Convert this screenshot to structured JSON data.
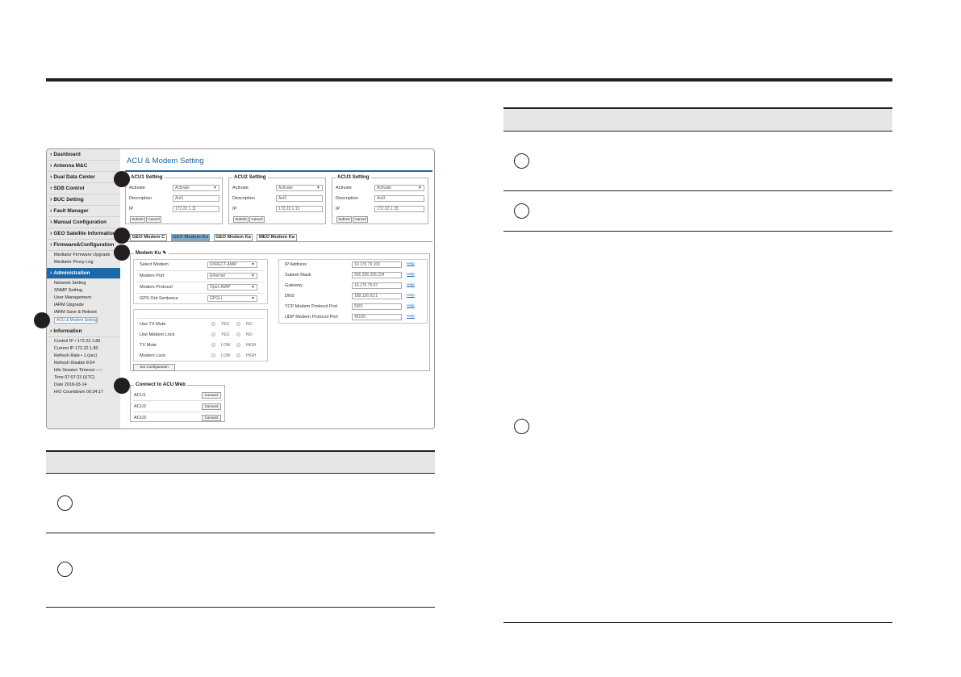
{
  "screenshot": {
    "nav": [
      {
        "label": "Dashboard"
      },
      {
        "label": "Antenna M&C"
      },
      {
        "label": "Dual Data Center"
      },
      {
        "label": "SDB Control"
      },
      {
        "label": "BUC Setting"
      },
      {
        "label": "Fault Manager"
      },
      {
        "label": "Manual Configuration"
      },
      {
        "label": "GEO Satellite Information"
      },
      {
        "label": "Firmware&Configuration"
      },
      {
        "label": "Administration"
      },
      {
        "label": "Information"
      }
    ],
    "firmware_sub": [
      "Mediator Firmware Upgrade",
      "Mediator Proxy Log"
    ],
    "admin_sub": [
      "Network Setting",
      "SNMP Setting",
      "User Management",
      "iARM Upgrade",
      "iARM Save & Reboot",
      "ACU & Modem Setting"
    ],
    "info_lines": [
      "Control IP • 172.22.1.80",
      "Current IP   172.22.1.80",
      "Refresh Rate •     1 (sec)",
      "Refresh Disable   8:54",
      "Idle Session Timeout  --:--",
      "Time  07:07:23 (UTC)",
      "Date  2018-03-14",
      "H/O Countdown   00:34:17"
    ],
    "page_title": "ACU & Modem Setting",
    "acu_panels": [
      {
        "legend": "ACU1 Setting",
        "activate_label": "Activate",
        "activate_value": "Activate",
        "desc_label": "Description",
        "desc_value": "Ant1",
        "ip_label": "IP",
        "ip_value": "172.22.1.11",
        "submit": "Submit",
        "cancel": "Cancel"
      },
      {
        "legend": "ACU2 Setting",
        "activate_label": "Activate",
        "activate_value": "Activate",
        "desc_label": "Description",
        "desc_value": "Ant2",
        "ip_label": "IP",
        "ip_value": "172.22.1.13",
        "submit": "Submit",
        "cancel": "Cancel"
      },
      {
        "legend": "ACU3 Setting",
        "activate_label": "Activate",
        "activate_value": "Activate",
        "desc_label": "Description",
        "desc_value": "Ant3",
        "ip_label": "IP",
        "ip_value": "172.22.1.15",
        "submit": "Submit",
        "cancel": "Cancel"
      }
    ],
    "tabs": [
      "GEO Modem C",
      "GEO Modem Ku",
      "GEO Modem Ka",
      "MEO Modem Ka"
    ],
    "modem_legend": "Modem Ku",
    "modem_left": [
      {
        "label": "Select Modem",
        "value": "IDIRECT-AMIP"
      },
      {
        "label": "Modem Port",
        "value": "Ethernet"
      },
      {
        "label": "Modem Protocol",
        "value": "Open AMIP"
      },
      {
        "label": "GPS Out Sentence",
        "value": "GPGLL"
      }
    ],
    "modem_right": [
      {
        "label": "IP Address",
        "value": "10.170.79.100",
        "help": "Help"
      },
      {
        "label": "Subnet Mask",
        "value": "255.255.255.224",
        "help": "Help"
      },
      {
        "label": "Gateway",
        "value": "10.170.79.97",
        "help": "Help"
      },
      {
        "label": "DNS",
        "value": "168.126.63.1",
        "help": "Help"
      },
      {
        "label": "TCP Modem Protocol Port",
        "value": "5001",
        "help": "Help"
      },
      {
        "label": "UDP Modem Protocol Port",
        "value": "45105",
        "help": "Help"
      }
    ],
    "radios": [
      {
        "label": "Use TX Mute",
        "a": "YES",
        "b": "NO"
      },
      {
        "label": "Use Modem Lock",
        "a": "YES",
        "b": "NO"
      },
      {
        "label": "TX Mute",
        "a": "LOW",
        "b": "HIGH"
      },
      {
        "label": "Modem Lock",
        "a": "LOW",
        "b": "HIGH"
      }
    ],
    "set_config": "Set Configuration",
    "connect_legend": "Connect to ACU Web",
    "connect_rows": [
      {
        "label": "ACU1",
        "btn": "Connect"
      },
      {
        "label": "ACU2",
        "btn": "Connect"
      },
      {
        "label": "ACU3",
        "btn": "Connect"
      }
    ]
  }
}
